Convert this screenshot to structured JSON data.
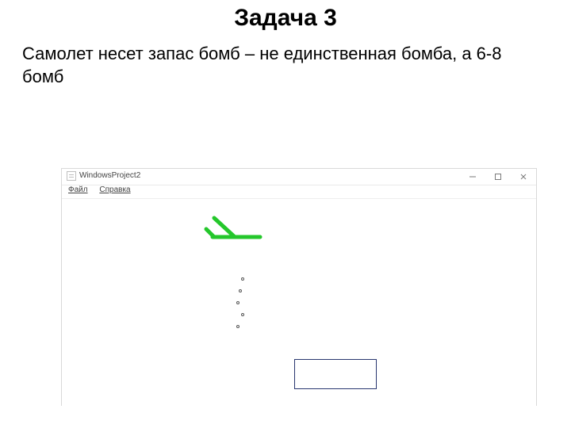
{
  "title": "Задача 3",
  "body": "Самолет несет запас бомб – не единственная бомба, а 6-8 бомб",
  "window": {
    "title": "WindowsProject2",
    "menu": {
      "file": "Файл",
      "help": "Справка"
    },
    "buttons": {
      "minimize": "—",
      "maximize": "☐",
      "close": "✕"
    }
  },
  "scene": {
    "plane_color": "#24c72b",
    "bomb_count": 5,
    "target_border": "#28366f"
  }
}
